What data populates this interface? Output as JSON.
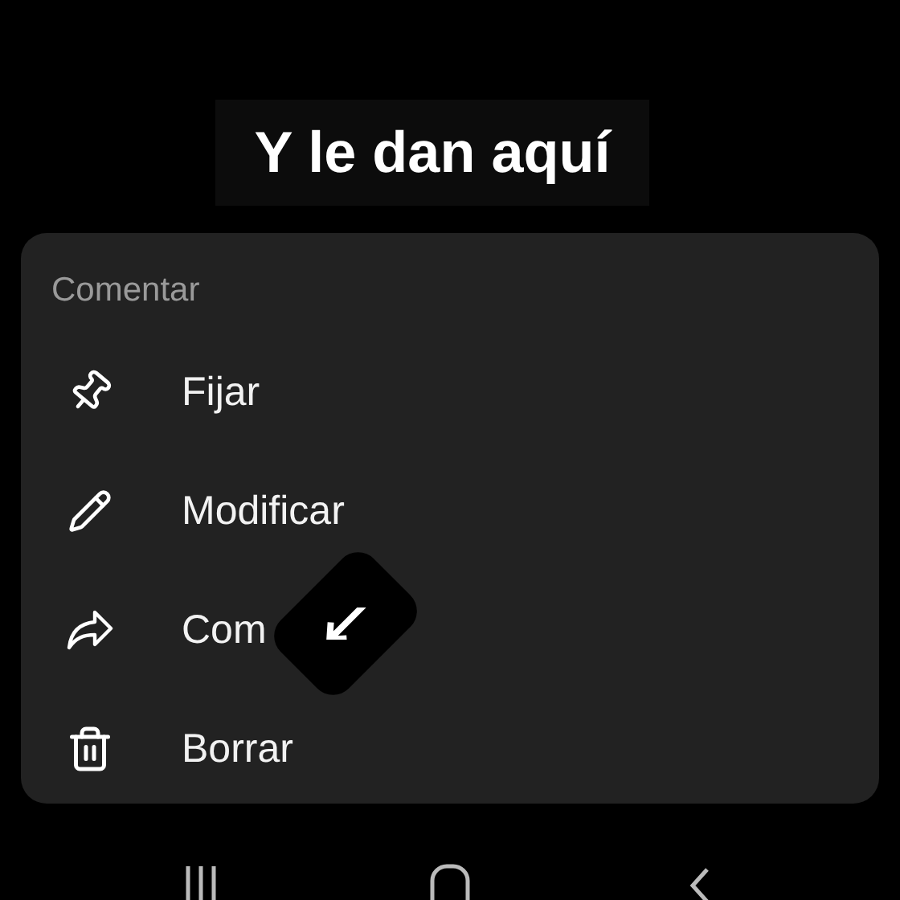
{
  "caption": "Y le dan aquí",
  "sheet": {
    "title": "Comentar",
    "items": [
      {
        "kind": "pin",
        "label": "Fijar"
      },
      {
        "kind": "edit",
        "label": "Modificar"
      },
      {
        "kind": "share",
        "label": "Com"
      },
      {
        "kind": "delete",
        "label": "Borrar"
      }
    ]
  },
  "nav": [
    {
      "kind": "recents"
    },
    {
      "kind": "home"
    },
    {
      "kind": "back"
    }
  ]
}
